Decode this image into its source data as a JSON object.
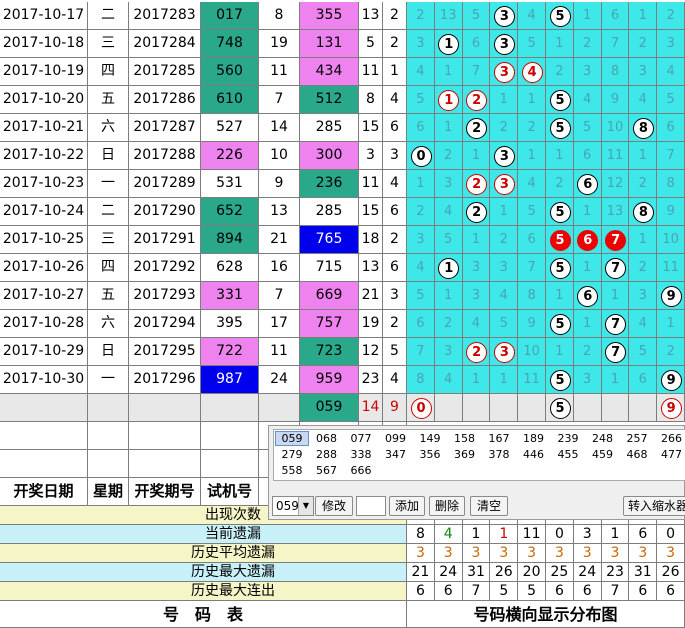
{
  "rows": [
    {
      "date": "2017-10-17",
      "wd": "二",
      "period": "2017283",
      "trial": "017",
      "n2": "8",
      "draw": "355",
      "sum": "13",
      "span": "2",
      "trial_bg": "#2aa88a",
      "draw_bg": "#ee82ee",
      "nums": [
        "2",
        "13",
        "5",
        "3",
        "4",
        "5",
        "1",
        "6",
        "1",
        "2"
      ],
      "hits": [
        3,
        5
      ]
    },
    {
      "date": "2017-10-18",
      "wd": "三",
      "period": "2017284",
      "trial": "748",
      "n2": "19",
      "draw": "131",
      "sum": "5",
      "span": "2",
      "trial_bg": "#2aa88a",
      "draw_bg": "#ee82ee",
      "nums": [
        "3",
        "1",
        "6",
        "3",
        "5",
        "1",
        "2",
        "7",
        "2",
        "3"
      ],
      "hits": [
        1,
        3
      ]
    },
    {
      "date": "2017-10-19",
      "wd": "四",
      "period": "2017285",
      "trial": "560",
      "n2": "11",
      "draw": "434",
      "sum": "11",
      "span": "1",
      "trial_bg": "#2aa88a",
      "draw_bg": "#ee82ee",
      "nums": [
        "4",
        "1",
        "7",
        "3",
        "4",
        "2",
        "3",
        "8",
        "3",
        "4"
      ],
      "hits": [
        3,
        4
      ],
      "red": [
        3,
        4
      ]
    },
    {
      "date": "2017-10-20",
      "wd": "五",
      "period": "2017286",
      "trial": "610",
      "n2": "7",
      "draw": "512",
      "sum": "8",
      "span": "4",
      "trial_bg": "#2aa88a",
      "draw_bg": "#2aa88a",
      "nums": [
        "5",
        "1",
        "2",
        "1",
        "1",
        "5",
        "4",
        "9",
        "4",
        "5"
      ],
      "hits": [
        1,
        2,
        5
      ],
      "red": [
        1,
        2
      ]
    },
    {
      "date": "2017-10-21",
      "wd": "六",
      "period": "2017287",
      "trial": "527",
      "n2": "14",
      "draw": "285",
      "sum": "15",
      "span": "6",
      "trial_bg": "#ffffff",
      "draw_bg": "#ffffff",
      "nums": [
        "6",
        "1",
        "2",
        "2",
        "2",
        "5",
        "5",
        "10",
        "8",
        "6"
      ],
      "hits": [
        2,
        5,
        8
      ]
    },
    {
      "date": "2017-10-22",
      "wd": "日",
      "period": "2017288",
      "trial": "226",
      "n2": "10",
      "draw": "300",
      "sum": "3",
      "span": "3",
      "trial_bg": "#ee82ee",
      "draw_bg": "#ee82ee",
      "nums": [
        "0",
        "2",
        "1",
        "3",
        "1",
        "1",
        "6",
        "11",
        "1",
        "7"
      ],
      "hits": [
        0,
        3
      ]
    },
    {
      "date": "2017-10-23",
      "wd": "一",
      "period": "2017289",
      "trial": "531",
      "n2": "9",
      "draw": "236",
      "sum": "11",
      "span": "4",
      "trial_bg": "#ffffff",
      "draw_bg": "#2aa88a",
      "nums": [
        "1",
        "3",
        "2",
        "3",
        "4",
        "2",
        "6",
        "12",
        "2",
        "8"
      ],
      "hits": [
        2,
        3,
        6
      ],
      "red": [
        2,
        3
      ]
    },
    {
      "date": "2017-10-24",
      "wd": "二",
      "period": "2017290",
      "trial": "652",
      "n2": "13",
      "draw": "285",
      "sum": "15",
      "span": "6",
      "trial_bg": "#2aa88a",
      "draw_bg": "#ffffff",
      "nums": [
        "2",
        "4",
        "2",
        "1",
        "5",
        "5",
        "1",
        "13",
        "8",
        "9"
      ],
      "hits": [
        2,
        5,
        8
      ]
    },
    {
      "date": "2017-10-25",
      "wd": "三",
      "period": "2017291",
      "trial": "894",
      "n2": "21",
      "draw": "765",
      "sum": "18",
      "span": "2",
      "trial_bg": "#2aa88a",
      "draw_bg": "#0000ee",
      "nums": [
        "3",
        "5",
        "1",
        "2",
        "6",
        "5",
        "6",
        "7",
        "1",
        "10"
      ],
      "hits": [
        5,
        6,
        7
      ],
      "fred": [
        5,
        6,
        7
      ]
    },
    {
      "date": "2017-10-26",
      "wd": "四",
      "period": "2017292",
      "trial": "628",
      "n2": "16",
      "draw": "715",
      "sum": "13",
      "span": "6",
      "trial_bg": "#ffffff",
      "draw_bg": "#ffffff",
      "nums": [
        "4",
        "1",
        "3",
        "3",
        "7",
        "5",
        "1",
        "7",
        "2",
        "11"
      ],
      "hits": [
        1,
        5,
        7
      ]
    },
    {
      "date": "2017-10-27",
      "wd": "五",
      "period": "2017293",
      "trial": "331",
      "n2": "7",
      "draw": "669",
      "sum": "21",
      "span": "3",
      "trial_bg": "#ee82ee",
      "draw_bg": "#ee82ee",
      "nums": [
        "5",
        "1",
        "3",
        "4",
        "8",
        "1",
        "6",
        "1",
        "3",
        "9"
      ],
      "hits": [
        6,
        9
      ]
    },
    {
      "date": "2017-10-28",
      "wd": "六",
      "period": "2017294",
      "trial": "395",
      "n2": "17",
      "draw": "757",
      "sum": "19",
      "span": "2",
      "trial_bg": "#ffffff",
      "draw_bg": "#ee82ee",
      "nums": [
        "6",
        "2",
        "4",
        "5",
        "9",
        "5",
        "1",
        "7",
        "4",
        "1"
      ],
      "hits": [
        5,
        7
      ]
    },
    {
      "date": "2017-10-29",
      "wd": "日",
      "period": "2017295",
      "trial": "722",
      "n2": "11",
      "draw": "723",
      "sum": "12",
      "span": "5",
      "trial_bg": "#ee82ee",
      "draw_bg": "#2aa88a",
      "nums": [
        "7",
        "3",
        "2",
        "3",
        "10",
        "1",
        "2",
        "7",
        "5",
        "2"
      ],
      "hits": [
        2,
        3,
        7
      ],
      "red": [
        2,
        3
      ]
    },
    {
      "date": "2017-10-30",
      "wd": "一",
      "period": "2017296",
      "trial": "987",
      "n2": "24",
      "draw": "959",
      "sum": "23",
      "span": "4",
      "trial_bg": "#0000ee",
      "draw_bg": "#ee82ee",
      "nums": [
        "8",
        "4",
        "1",
        "1",
        "11",
        "5",
        "3",
        "1",
        "6",
        "9"
      ],
      "hits": [
        5,
        9
      ]
    }
  ],
  "pending": {
    "draw": "059",
    "sum": "14",
    "span": "9",
    "balls": [
      {
        "col": 0,
        "val": "0",
        "red": true
      },
      {
        "col": 5,
        "val": "5",
        "red": false
      },
      {
        "col": 9,
        "val": "9",
        "red": true
      }
    ]
  },
  "header": {
    "date": "开奖日期",
    "weekday": "星期",
    "period": "开奖期号",
    "trial": "试机号",
    "cut": "试"
  },
  "stats": [
    {
      "label": "出现次数",
      "values": [
        "",
        "",
        "",
        "",
        "",
        "",
        "",
        "",
        "",
        ""
      ],
      "bg": "#f5f5c8"
    },
    {
      "label": "当前遗漏",
      "values": [
        "8",
        "4",
        "1",
        "1",
        "11",
        "0",
        "3",
        "1",
        "6",
        "0"
      ],
      "bg": "#c8f0f8",
      "colors": [
        "#000",
        "#118811",
        "#000",
        "#cc0000",
        "#000",
        "#000",
        "#000",
        "#000",
        "#000",
        "#000"
      ]
    },
    {
      "label": "历史平均遗漏",
      "values": [
        "3",
        "3",
        "3",
        "3",
        "3",
        "3",
        "3",
        "3",
        "3",
        "3"
      ],
      "bg": "#f5f5c8",
      "color": "#cc6600"
    },
    {
      "label": "历史最大遗漏",
      "values": [
        "21",
        "24",
        "31",
        "26",
        "20",
        "25",
        "24",
        "23",
        "31",
        "26"
      ],
      "bg": "#c8f0f8"
    },
    {
      "label": "历史最大连出",
      "values": [
        "6",
        "6",
        "7",
        "5",
        "5",
        "6",
        "6",
        "7",
        "6",
        "6"
      ],
      "bg": "#f5f5c8"
    }
  ],
  "footer": {
    "left": "号　码　表",
    "right": "号码横向显示分布图"
  },
  "panel": {
    "list": [
      "059",
      "068",
      "077",
      "099",
      "149",
      "158",
      "167",
      "189",
      "239",
      "248",
      "257",
      "266",
      "279",
      "288",
      "338",
      "347",
      "356",
      "369",
      "378",
      "446",
      "455",
      "459",
      "468",
      "477",
      "558",
      "567",
      "666"
    ],
    "combo_value": "059",
    "buttons": {
      "modify": "修改",
      "add": "添加",
      "delete": "删除",
      "clear": "清空",
      "import": "转入缩水器"
    }
  }
}
